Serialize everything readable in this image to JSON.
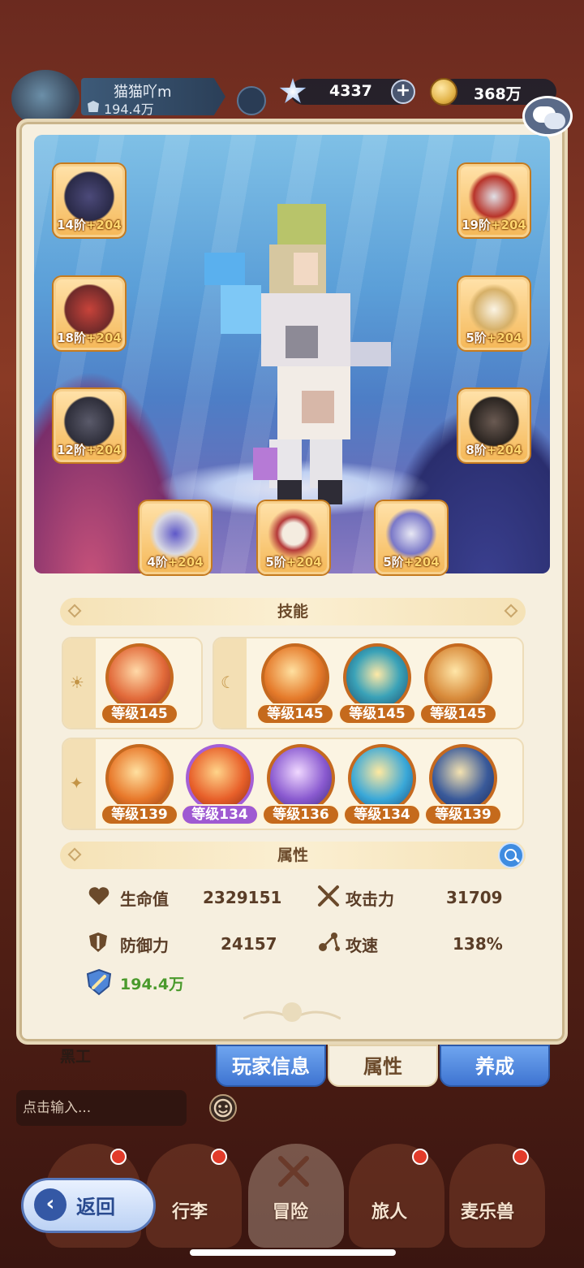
{
  "player": {
    "name": "猫猫吖m",
    "power": "194.4万"
  },
  "resources": {
    "gems": "4337",
    "gold": "368万"
  },
  "equipment": [
    {
      "id": "helmet",
      "stage": "14阶",
      "plus": "+204"
    },
    {
      "id": "armor-red",
      "stage": "18阶",
      "plus": "+204"
    },
    {
      "id": "armor-dark",
      "stage": "12阶",
      "plus": "+204"
    },
    {
      "id": "mask",
      "stage": "19阶",
      "plus": "+204"
    },
    {
      "id": "gauntlet",
      "stage": "5阶",
      "plus": "+204"
    },
    {
      "id": "boots",
      "stage": "8阶",
      "plus": "+204"
    },
    {
      "id": "ring",
      "stage": "4阶",
      "plus": "+204"
    },
    {
      "id": "necklace",
      "stage": "5阶",
      "plus": "+204"
    },
    {
      "id": "charm",
      "stage": "5阶",
      "plus": "+204"
    }
  ],
  "skills_header": "技能",
  "skills_row1_left": [
    {
      "level": "等级145"
    }
  ],
  "skills_row1_right": [
    {
      "level": "等级145"
    },
    {
      "level": "等级145"
    },
    {
      "level": "等级145"
    }
  ],
  "skills_row2": [
    {
      "level": "等级139"
    },
    {
      "level": "等级134"
    },
    {
      "level": "等级136"
    },
    {
      "level": "等级134"
    },
    {
      "level": "等级139"
    }
  ],
  "attributes_header": "属性",
  "attributes": {
    "hp_label": "生命值",
    "hp": "2329151",
    "atk_label": "攻击力",
    "atk": "31709",
    "def_label": "防御力",
    "def": "24157",
    "spd_label": "攻速",
    "spd": "138%",
    "power": "194.4万"
  },
  "tabs": {
    "player_info": "玩家信息",
    "attributes": "属性",
    "develop": "养成"
  },
  "chat": {
    "blackwork": "黑工",
    "placeholder": "点击输入..."
  },
  "nav": {
    "back": "返回",
    "luggage": "行李",
    "adventure": "冒险",
    "traveler": "旅人",
    "pets": "麦乐兽"
  },
  "colors": {
    "accent": "#c56a1c",
    "violet": "#9f5ad2",
    "tab_blue": "#3f74d1"
  }
}
